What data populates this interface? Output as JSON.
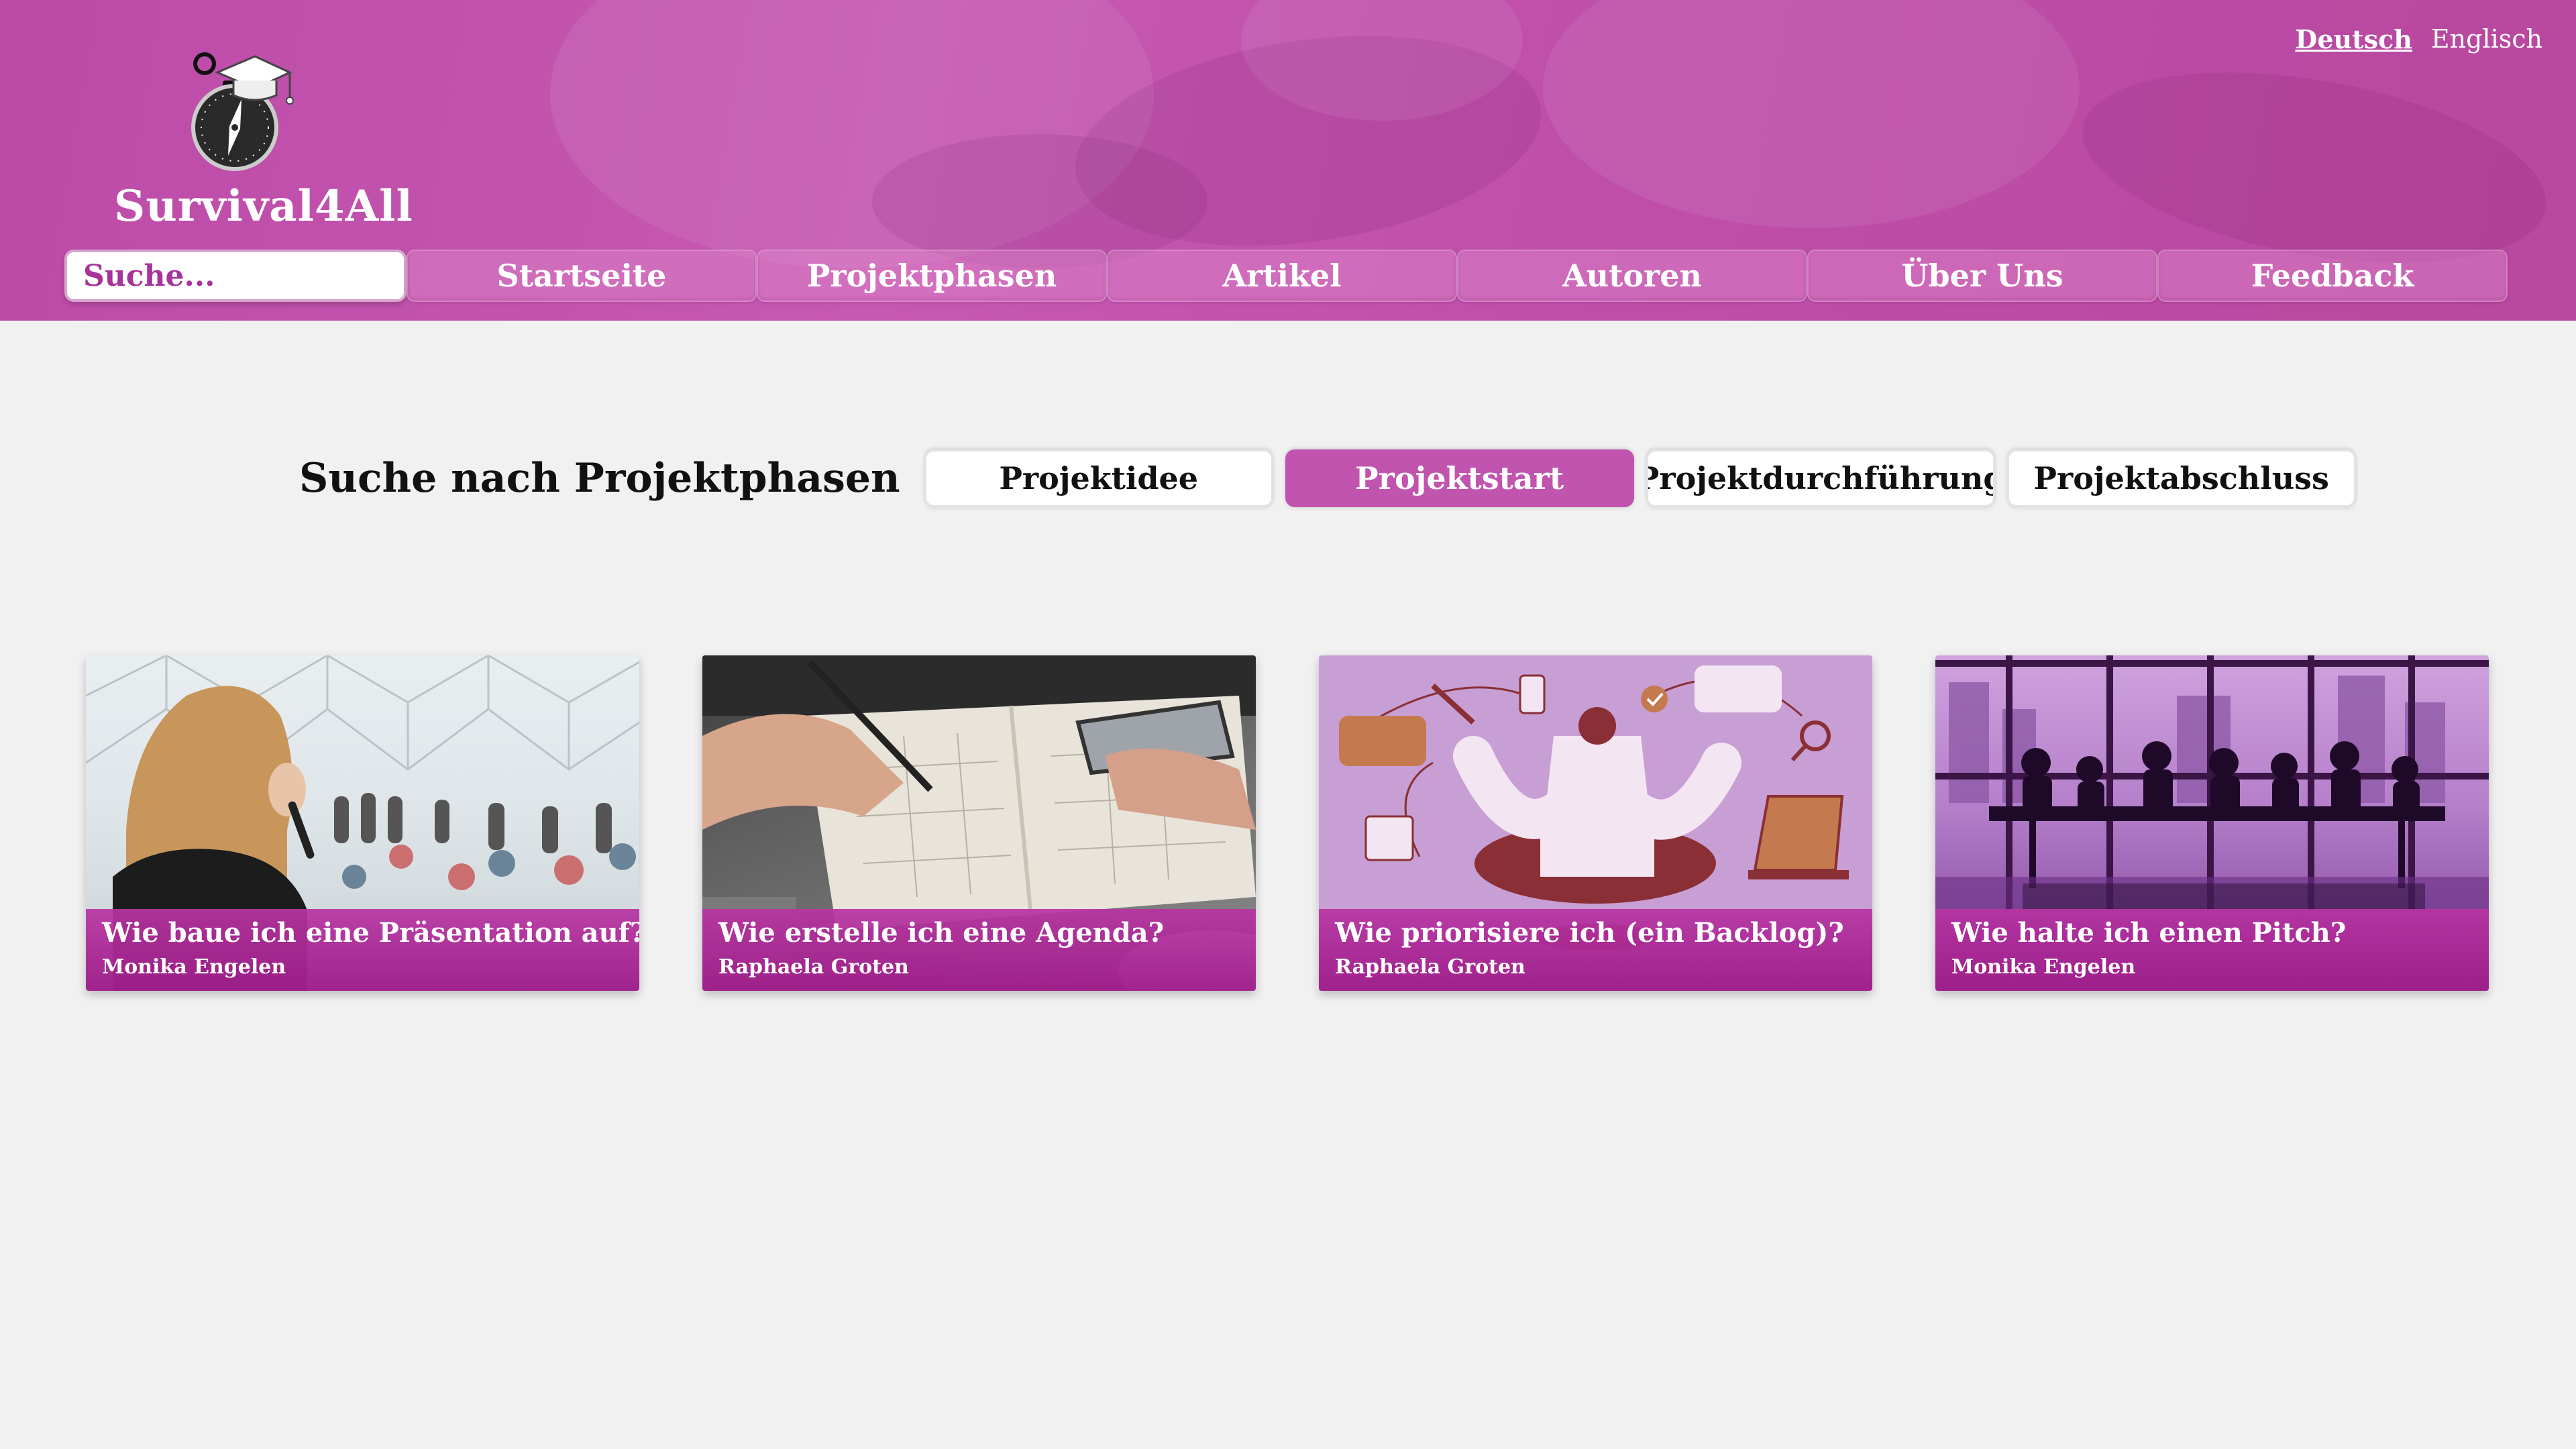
{
  "header": {
    "brand": "Survival4All",
    "languages": [
      {
        "label": "Deutsch",
        "active": true
      },
      {
        "label": "Englisch",
        "active": false
      }
    ],
    "search": {
      "placeholder": "Suche..."
    },
    "nav": [
      "Startseite",
      "Projektphasen",
      "Artikel",
      "Autoren",
      "Über Uns",
      "Feedback"
    ]
  },
  "phases": {
    "title": "Suche nach Projektphasen",
    "buttons": [
      {
        "label": "Projektidee",
        "active": false
      },
      {
        "label": "Projektstart",
        "active": true
      },
      {
        "label": "Projektdurchführung",
        "active": false
      },
      {
        "label": "Projektabschluss",
        "active": false
      }
    ]
  },
  "cards": [
    {
      "title": "Wie baue ich eine Präsentation auf?",
      "author": "Monika Engelen"
    },
    {
      "title": "Wie erstelle ich eine Agenda?",
      "author": "Raphaela Groten"
    },
    {
      "title": "Wie priorisiere ich (ein Backlog)?",
      "author": "Raphaela Groten"
    },
    {
      "title": "Wie halte ich einen Pitch?",
      "author": "Monika Engelen"
    }
  ],
  "colors": {
    "accent": "#c154ae",
    "header": "#c257b0",
    "background": "#f1f1f1"
  }
}
